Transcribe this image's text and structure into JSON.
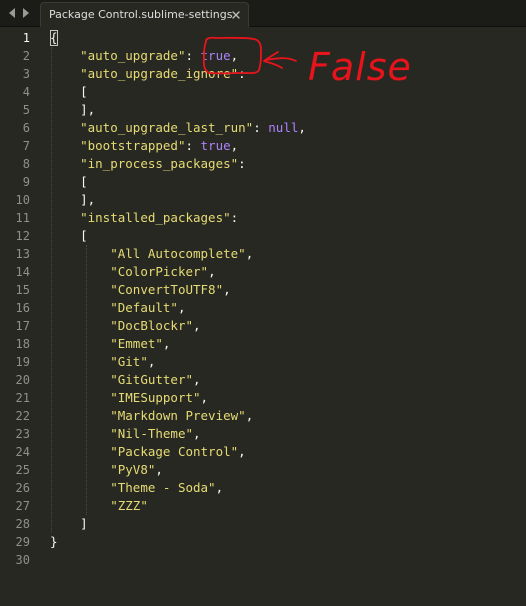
{
  "tab": {
    "title": "Package Control.sublime-settings",
    "close_icon": "close-x-icon"
  },
  "nav": {
    "back_icon": "triangle-left-icon",
    "forward_icon": "triangle-right-icon"
  },
  "gutter": {
    "current_line": 1
  },
  "lines": [
    [
      {
        "t": "{",
        "c": "punct"
      }
    ],
    [
      {
        "t": "    ",
        "c": "punct"
      },
      {
        "t": "\"auto_upgrade\"",
        "c": "str"
      },
      {
        "t": ": ",
        "c": "punct"
      },
      {
        "t": "true",
        "c": "const"
      },
      {
        "t": ",",
        "c": "punct"
      }
    ],
    [
      {
        "t": "    ",
        "c": "punct"
      },
      {
        "t": "\"auto_upgrade_ignore\"",
        "c": "str"
      },
      {
        "t": ":",
        "c": "punct"
      }
    ],
    [
      {
        "t": "    [",
        "c": "punct"
      }
    ],
    [
      {
        "t": "    ],",
        "c": "punct"
      }
    ],
    [
      {
        "t": "    ",
        "c": "punct"
      },
      {
        "t": "\"auto_upgrade_last_run\"",
        "c": "str"
      },
      {
        "t": ": ",
        "c": "punct"
      },
      {
        "t": "null",
        "c": "const"
      },
      {
        "t": ",",
        "c": "punct"
      }
    ],
    [
      {
        "t": "    ",
        "c": "punct"
      },
      {
        "t": "\"bootstrapped\"",
        "c": "str"
      },
      {
        "t": ": ",
        "c": "punct"
      },
      {
        "t": "true",
        "c": "const"
      },
      {
        "t": ",",
        "c": "punct"
      }
    ],
    [
      {
        "t": "    ",
        "c": "punct"
      },
      {
        "t": "\"in_process_packages\"",
        "c": "str"
      },
      {
        "t": ":",
        "c": "punct"
      }
    ],
    [
      {
        "t": "    [",
        "c": "punct"
      }
    ],
    [
      {
        "t": "    ],",
        "c": "punct"
      }
    ],
    [
      {
        "t": "    ",
        "c": "punct"
      },
      {
        "t": "\"installed_packages\"",
        "c": "str"
      },
      {
        "t": ":",
        "c": "punct"
      }
    ],
    [
      {
        "t": "    [",
        "c": "punct"
      }
    ],
    [
      {
        "t": "        ",
        "c": "punct"
      },
      {
        "t": "\"All Autocomplete\"",
        "c": "str"
      },
      {
        "t": ",",
        "c": "punct"
      }
    ],
    [
      {
        "t": "        ",
        "c": "punct"
      },
      {
        "t": "\"ColorPicker\"",
        "c": "str"
      },
      {
        "t": ",",
        "c": "punct"
      }
    ],
    [
      {
        "t": "        ",
        "c": "punct"
      },
      {
        "t": "\"ConvertToUTF8\"",
        "c": "str"
      },
      {
        "t": ",",
        "c": "punct"
      }
    ],
    [
      {
        "t": "        ",
        "c": "punct"
      },
      {
        "t": "\"Default\"",
        "c": "str"
      },
      {
        "t": ",",
        "c": "punct"
      }
    ],
    [
      {
        "t": "        ",
        "c": "punct"
      },
      {
        "t": "\"DocBlockr\"",
        "c": "str"
      },
      {
        "t": ",",
        "c": "punct"
      }
    ],
    [
      {
        "t": "        ",
        "c": "punct"
      },
      {
        "t": "\"Emmet\"",
        "c": "str"
      },
      {
        "t": ",",
        "c": "punct"
      }
    ],
    [
      {
        "t": "        ",
        "c": "punct"
      },
      {
        "t": "\"Git\"",
        "c": "str"
      },
      {
        "t": ",",
        "c": "punct"
      }
    ],
    [
      {
        "t": "        ",
        "c": "punct"
      },
      {
        "t": "\"GitGutter\"",
        "c": "str"
      },
      {
        "t": ",",
        "c": "punct"
      }
    ],
    [
      {
        "t": "        ",
        "c": "punct"
      },
      {
        "t": "\"IMESupport\"",
        "c": "str"
      },
      {
        "t": ",",
        "c": "punct"
      }
    ],
    [
      {
        "t": "        ",
        "c": "punct"
      },
      {
        "t": "\"Markdown Preview\"",
        "c": "str"
      },
      {
        "t": ",",
        "c": "punct"
      }
    ],
    [
      {
        "t": "        ",
        "c": "punct"
      },
      {
        "t": "\"Nil-Theme\"",
        "c": "str"
      },
      {
        "t": ",",
        "c": "punct"
      }
    ],
    [
      {
        "t": "        ",
        "c": "punct"
      },
      {
        "t": "\"Package Control\"",
        "c": "str"
      },
      {
        "t": ",",
        "c": "punct"
      }
    ],
    [
      {
        "t": "        ",
        "c": "punct"
      },
      {
        "t": "\"PyV8\"",
        "c": "str"
      },
      {
        "t": ",",
        "c": "punct"
      }
    ],
    [
      {
        "t": "        ",
        "c": "punct"
      },
      {
        "t": "\"Theme - Soda\"",
        "c": "str"
      },
      {
        "t": ",",
        "c": "punct"
      }
    ],
    [
      {
        "t": "        ",
        "c": "punct"
      },
      {
        "t": "\"ZZZ\"",
        "c": "str"
      }
    ],
    [
      {
        "t": "    ]",
        "c": "punct"
      }
    ],
    [
      {
        "t": "}",
        "c": "punct"
      }
    ],
    [
      {
        "t": "",
        "c": "punct"
      }
    ]
  ],
  "annotation": {
    "text": "False",
    "color": "#e8141c"
  },
  "colors": {
    "background": "#272822",
    "string": "#e6db74",
    "constant": "#ae81ff",
    "text": "#f8f8f2",
    "line_number": "#8f908a"
  }
}
